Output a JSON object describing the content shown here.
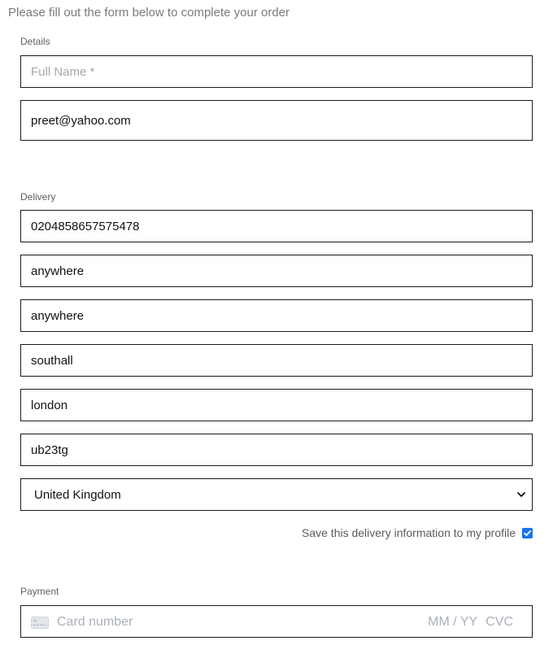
{
  "intro": "Please fill out the form below to complete your order",
  "details": {
    "label": "Details",
    "full_name_placeholder": "Full Name *",
    "full_name_value": "",
    "email_value": "preet@yahoo.com"
  },
  "delivery": {
    "label": "Delivery",
    "phone": "0204858657575478",
    "address_line1": "anywhere",
    "address_line2": "anywhere",
    "town": "southall",
    "county": "london",
    "postcode": "ub23tg",
    "country_selected": "United Kingdom",
    "save_label": "Save this delivery information to my profile",
    "save_checked": true
  },
  "payment": {
    "label": "Payment",
    "card_placeholder": "Card number",
    "expiry_placeholder": "MM / YY",
    "cvc_placeholder": "CVC"
  },
  "colors": {
    "checkbox": "#1a73e8",
    "border": "#1a1a1a",
    "placeholder": "#a8a8a8"
  },
  "icons": {
    "card": "credit-card-icon",
    "select": "chevron-down-icon",
    "checkbox": "checkmark-icon"
  }
}
